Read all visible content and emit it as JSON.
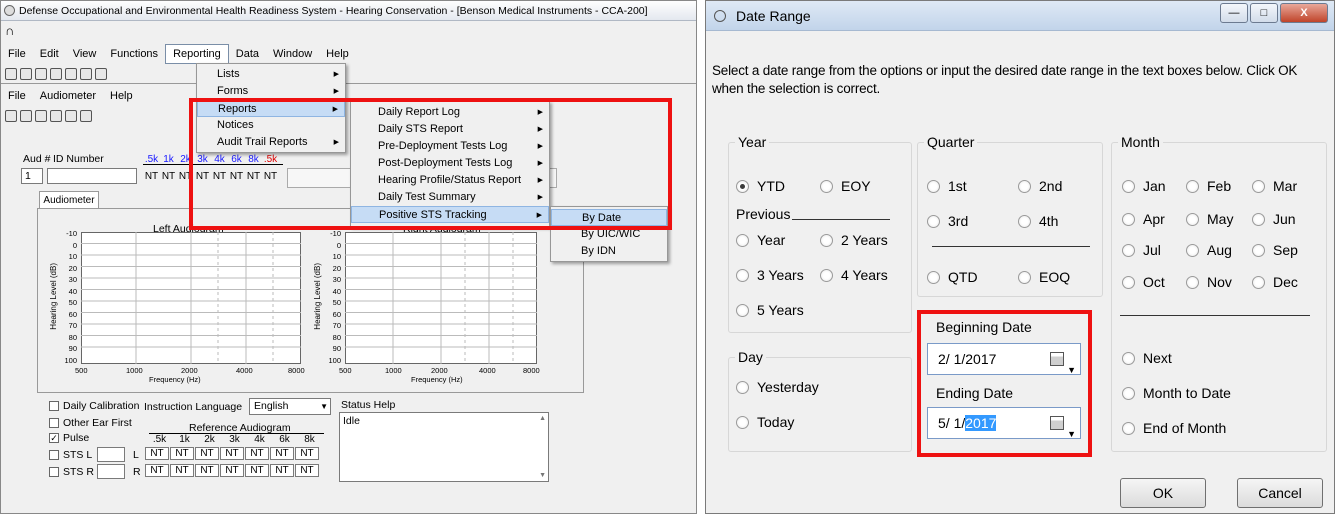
{
  "left_window": {
    "title": "Defense Occupational and Environmental Health Readiness System - Hearing Conservation - [Benson Medical Instruments - CCA-200]",
    "main_menu": [
      "File",
      "Edit",
      "View",
      "Functions",
      "Reporting",
      "Data",
      "Window",
      "Help"
    ],
    "child_menu": [
      "File",
      "Audiometer",
      "Help"
    ],
    "reporting_menu": {
      "items": [
        {
          "label": "Lists",
          "submenu": true
        },
        {
          "label": "Forms",
          "submenu": true
        },
        {
          "label": "Reports",
          "submenu": true
        },
        {
          "label": "Notices",
          "submenu": false
        },
        {
          "label": "Audit Trail Reports",
          "submenu": true
        }
      ]
    },
    "reports_submenu": {
      "items": [
        "Daily Report Log",
        "Daily STS Report",
        "Pre-Deployment Tests Log",
        "Post-Deployment Tests Log",
        "Hearing Profile/Status Report",
        "Daily Test Summary",
        "Positive STS Tracking"
      ]
    },
    "sts_submenu": {
      "items": [
        "By Date",
        "By UIC/WIC",
        "By IDN"
      ]
    },
    "aud_header": {
      "aud_label": "Aud #",
      "id_label": "ID Number",
      "aud_value": "1",
      "freqs": [
        ".5k",
        "1k",
        "2k",
        "3k",
        "4k",
        "6k",
        "8k",
        ".5k"
      ],
      "nt_values": [
        "NT",
        "NT",
        "NT",
        "NT",
        "NT",
        "NT",
        "NT",
        "NT"
      ]
    },
    "audiometer_tab": "Audiometer",
    "left_chart": {
      "title": "Left Audiogram",
      "ylabel": "Hearing Level (dB)",
      "xlabel": "Frequency (Hz)",
      "yticks": [
        "-10",
        "0",
        "10",
        "20",
        "30",
        "40",
        "50",
        "60",
        "70",
        "80",
        "90",
        "100"
      ],
      "xticks": [
        "500",
        "1000",
        "2000",
        "4000",
        "8000"
      ]
    },
    "right_chart": {
      "title": "Right Audiogram",
      "ylabel": "Hearing Level (dB)",
      "xlabel": "Frequency (Hz)",
      "yticks": [
        "-10",
        "0",
        "10",
        "20",
        "30",
        "40",
        "50",
        "60",
        "70",
        "80",
        "90",
        "100"
      ],
      "xticks": [
        "500",
        "1000",
        "2000",
        "4000",
        "8000"
      ]
    },
    "bottom": {
      "daily_calibration": "Daily Calibration",
      "instruction_language_label": "Instruction Language",
      "instruction_language_value": "English",
      "other_ear_first": "Other Ear First",
      "pulse": "Pulse",
      "sts_l": "STS L",
      "sts_r": "STS R",
      "reference_audiogram": "Reference Audiogram",
      "ref_freqs": [
        ".5k",
        "1k",
        "2k",
        "3k",
        "4k",
        "6k",
        "8k"
      ],
      "row_l": "L",
      "row_r": "R",
      "ref_values_l": [
        "NT",
        "NT",
        "NT",
        "NT",
        "NT",
        "NT",
        "NT"
      ],
      "ref_values_r": [
        "NT",
        "NT",
        "NT",
        "NT",
        "NT",
        "NT",
        "NT"
      ],
      "status_help_label": "Status Help",
      "status_value": "Idle"
    }
  },
  "right_window": {
    "title": "Date Range",
    "instructions": "Select a date range from the options or input the desired date range in the text boxes below. Click OK when the selection is correct.",
    "year_group": {
      "label": "Year",
      "ytd": "YTD",
      "eoy": "EOY",
      "previous": "Previous",
      "year": "Year",
      "two_years": "2 Years",
      "three_years": "3 Years",
      "four_years": "4 Years",
      "five_years": "5 Years",
      "selected": "YTD"
    },
    "quarter_group": {
      "label": "Quarter",
      "q1": "1st",
      "q2": "2nd",
      "q3": "3rd",
      "q4": "4th",
      "qtd": "QTD",
      "eoq": "EOQ"
    },
    "month_group": {
      "label": "Month",
      "months": [
        "Jan",
        "Feb",
        "Mar",
        "Apr",
        "May",
        "Jun",
        "Jul",
        "Aug",
        "Sep",
        "Oct",
        "Nov",
        "Dec"
      ],
      "next": "Next",
      "month_to_date": "Month to Date",
      "end_of_month": "End of Month"
    },
    "day_group": {
      "label": "Day",
      "yesterday": "Yesterday",
      "today": "Today"
    },
    "beginning_date_label": "Beginning Date",
    "beginning_date": "2/ 1/2017",
    "ending_date_label": "Ending Date",
    "ending_date_prefix": "5/ 1/",
    "ending_date_selected": "2017",
    "ok": "OK",
    "cancel": "Cancel"
  },
  "colors": {
    "highlight_red": "#ee1111",
    "menu_highlight": "#c6dcf5",
    "selection_blue": "#3399ff",
    "freq_blue": "#1a1aff",
    "freq_red": "#e00000"
  }
}
